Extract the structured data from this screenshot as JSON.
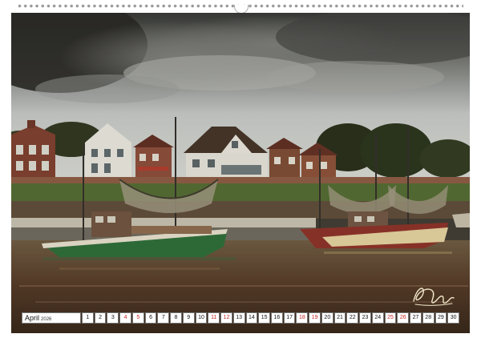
{
  "calendar": {
    "month": "April",
    "year": "2026",
    "days": [
      "1",
      "2",
      "3",
      "4",
      "5",
      "6",
      "7",
      "8",
      "9",
      "10",
      "11",
      "12",
      "13",
      "14",
      "15",
      "16",
      "17",
      "18",
      "19",
      "20",
      "21",
      "22",
      "23",
      "24",
      "25",
      "26",
      "27",
      "28",
      "29",
      "30"
    ],
    "weekend_days": [
      "4",
      "5",
      "11",
      "12",
      "18",
      "19",
      "25",
      "26"
    ],
    "weekday_color": "#111111",
    "weekend_color": "#c62828"
  },
  "photo": {
    "subject": "harbor with fishing cutters, houses and stormy sky",
    "sky_color": "#cfd6d8",
    "cloud_color": "#5a5e60",
    "water_color": "#5a3e2c"
  },
  "icons": {
    "signature": "signature-icon",
    "hanger": "hanger-icon"
  }
}
